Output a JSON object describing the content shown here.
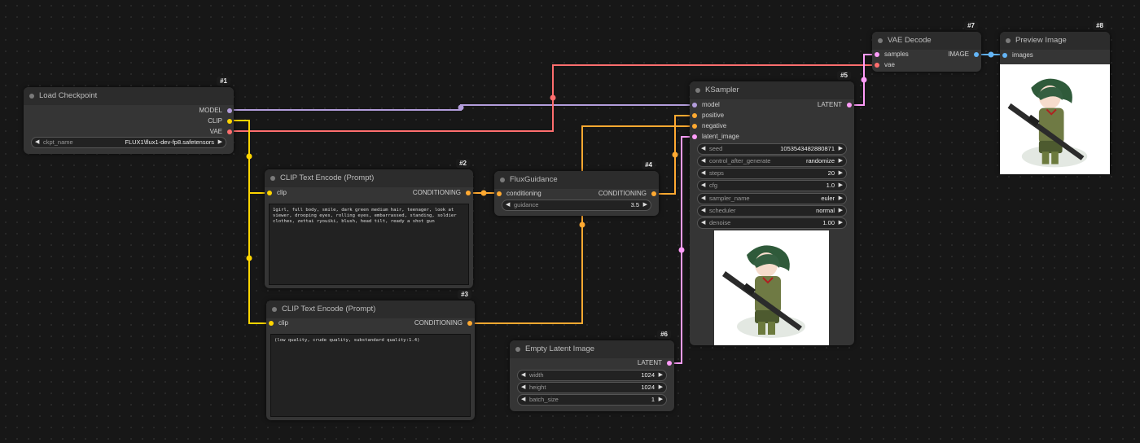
{
  "colors": {
    "model": "#b39ddb",
    "clip": "#ffd500",
    "vae": "#ff6e6e",
    "conditioning": "#ffa931",
    "latent": "#ff9cf9",
    "image": "#64b5f6"
  },
  "nodes": {
    "load_checkpoint": {
      "id": "#1",
      "title": "Load Checkpoint",
      "outputs": [
        "MODEL",
        "CLIP",
        "VAE"
      ],
      "ckpt_name": {
        "label": "ckpt_name",
        "value": "FLUX1\\flux1-dev-fp8.safetensors"
      }
    },
    "clip_text_pos": {
      "id": "#2",
      "title": "CLIP Text Encode (Prompt)",
      "input": "clip",
      "output": "CONDITIONING",
      "text": "1girl, full body, smile, dark green medium hair, teenager, look at viewer, drooping eyes, rolling eyes, embarrassed, standing, soldier clothes, zettai ryouiki, blush, head tilt, ready a shot gun"
    },
    "clip_text_neg": {
      "id": "#3",
      "title": "CLIP Text Encode (Prompt)",
      "input": "clip",
      "output": "CONDITIONING",
      "text": "(low quality, crude quality, substandard quality:1.4)"
    },
    "flux_guidance": {
      "id": "#4",
      "title": "FluxGuidance",
      "input": "conditioning",
      "output": "CONDITIONING",
      "guidance": {
        "label": "guidance",
        "value": "3.5"
      }
    },
    "ksampler": {
      "id": "#5",
      "title": "KSampler",
      "inputs": [
        "model",
        "positive",
        "negative",
        "latent_image"
      ],
      "output": "LATENT",
      "widgets": [
        {
          "label": "seed",
          "value": "1053543482880871"
        },
        {
          "label": "control_after_generate",
          "value": "randomize"
        },
        {
          "label": "steps",
          "value": "20"
        },
        {
          "label": "cfg",
          "value": "1.0"
        },
        {
          "label": "sampler_name",
          "value": "euler"
        },
        {
          "label": "scheduler",
          "value": "normal"
        },
        {
          "label": "denoise",
          "value": "1.00"
        }
      ]
    },
    "empty_latent": {
      "id": "#6",
      "title": "Empty Latent Image",
      "output": "LATENT",
      "widgets": [
        {
          "label": "width",
          "value": "1024"
        },
        {
          "label": "height",
          "value": "1024"
        },
        {
          "label": "batch_size",
          "value": "1"
        }
      ]
    },
    "vae_decode": {
      "id": "#7",
      "title": "VAE Decode",
      "inputs": [
        "samples",
        "vae"
      ],
      "output": "IMAGE"
    },
    "preview_image": {
      "id": "#8",
      "title": "Preview Image",
      "input": "images"
    }
  }
}
